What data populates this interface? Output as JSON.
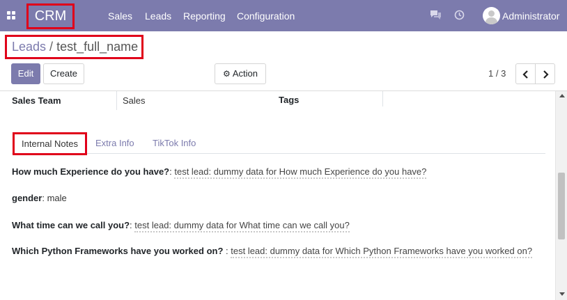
{
  "navbar": {
    "app_name": "CRM",
    "menu": [
      "Sales",
      "Leads",
      "Reporting",
      "Configuration"
    ],
    "user_name": "Administrator",
    "icons": [
      "apps-grid-icon",
      "chat-icon",
      "clock-icon",
      "user-avatar"
    ],
    "background": "#7c7bad"
  },
  "breadcrumb": {
    "parent": "Leads",
    "separator": "/",
    "current": "test_full_name"
  },
  "toolbar": {
    "edit_label": "Edit",
    "create_label": "Create",
    "action_label": "Action",
    "pager_value": "1 / 3"
  },
  "form": {
    "sales_team_label": "Sales Team",
    "sales_team_value": "Sales",
    "tags_label": "Tags"
  },
  "tabs": [
    "Internal Notes",
    "Extra Info",
    "TikTok Info"
  ],
  "notes": [
    {
      "question": "How much Experience do you have?",
      "separator": ": ",
      "answer": "test lead: dummy data for How much Experience do you have?"
    },
    {
      "question": "gender",
      "separator": ": ",
      "answer": "male"
    },
    {
      "question": "What time can we call you?",
      "separator": ": ",
      "answer": "test lead: dummy data for What time can we call you?"
    },
    {
      "question": "Which Python Frameworks have you worked on? ",
      "separator": ": ",
      "answer": "test lead: dummy data for Which Python Frameworks have you worked on?"
    }
  ],
  "highlight_color": "#e0001a"
}
